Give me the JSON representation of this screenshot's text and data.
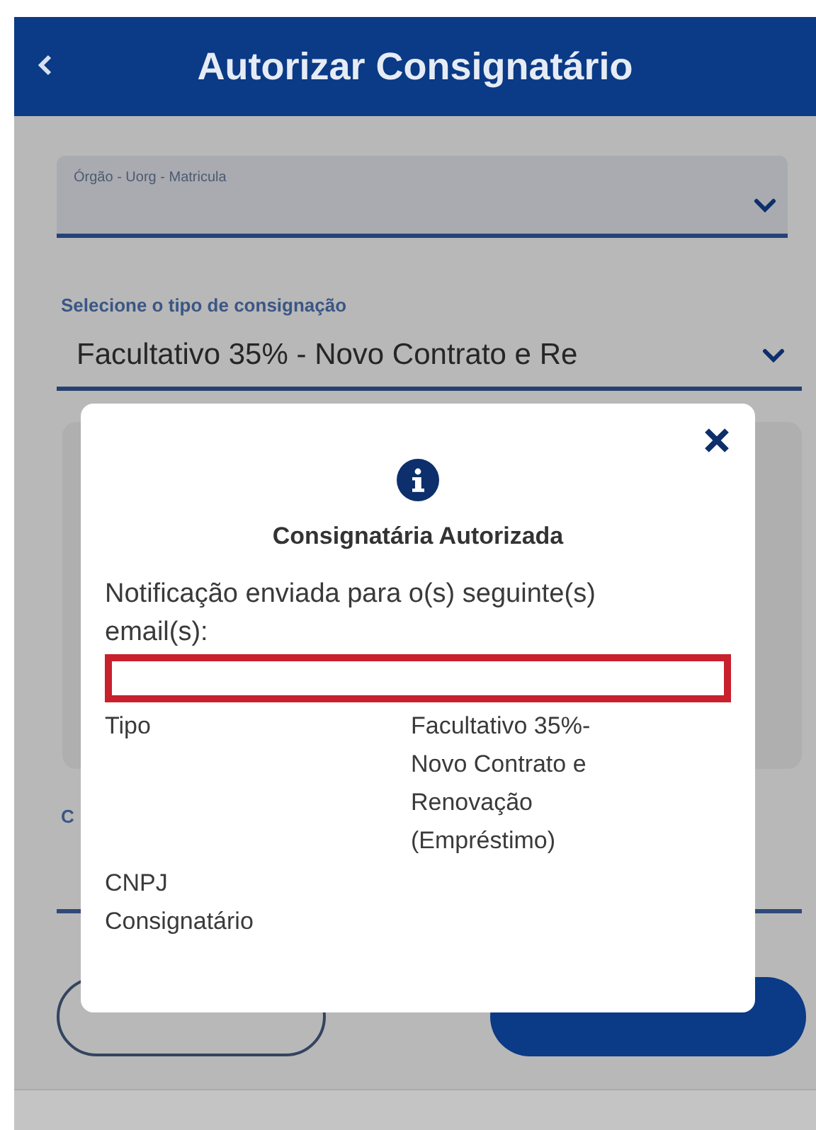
{
  "header": {
    "title": "Autorizar Consignatário"
  },
  "orgao_field": {
    "label": "Órgão - Uorg - Matricula"
  },
  "tipo_select": {
    "label": "Selecione o tipo de consignação",
    "value": "Facultativo 35%  - Novo Contrato e Re"
  },
  "covered_label": "C",
  "dialog": {
    "title": "Consignatária Autorizada",
    "message": "Notificação enviada para o(s) seguinte(s) email(s):",
    "email_box": {
      "highlighted": true
    },
    "rows": [
      {
        "label": "Tipo",
        "value": "Facultativo 35%- Novo Contrato e Renovação (Empréstimo)"
      },
      {
        "label": "CNPJ Consignatário"
      }
    ]
  }
}
